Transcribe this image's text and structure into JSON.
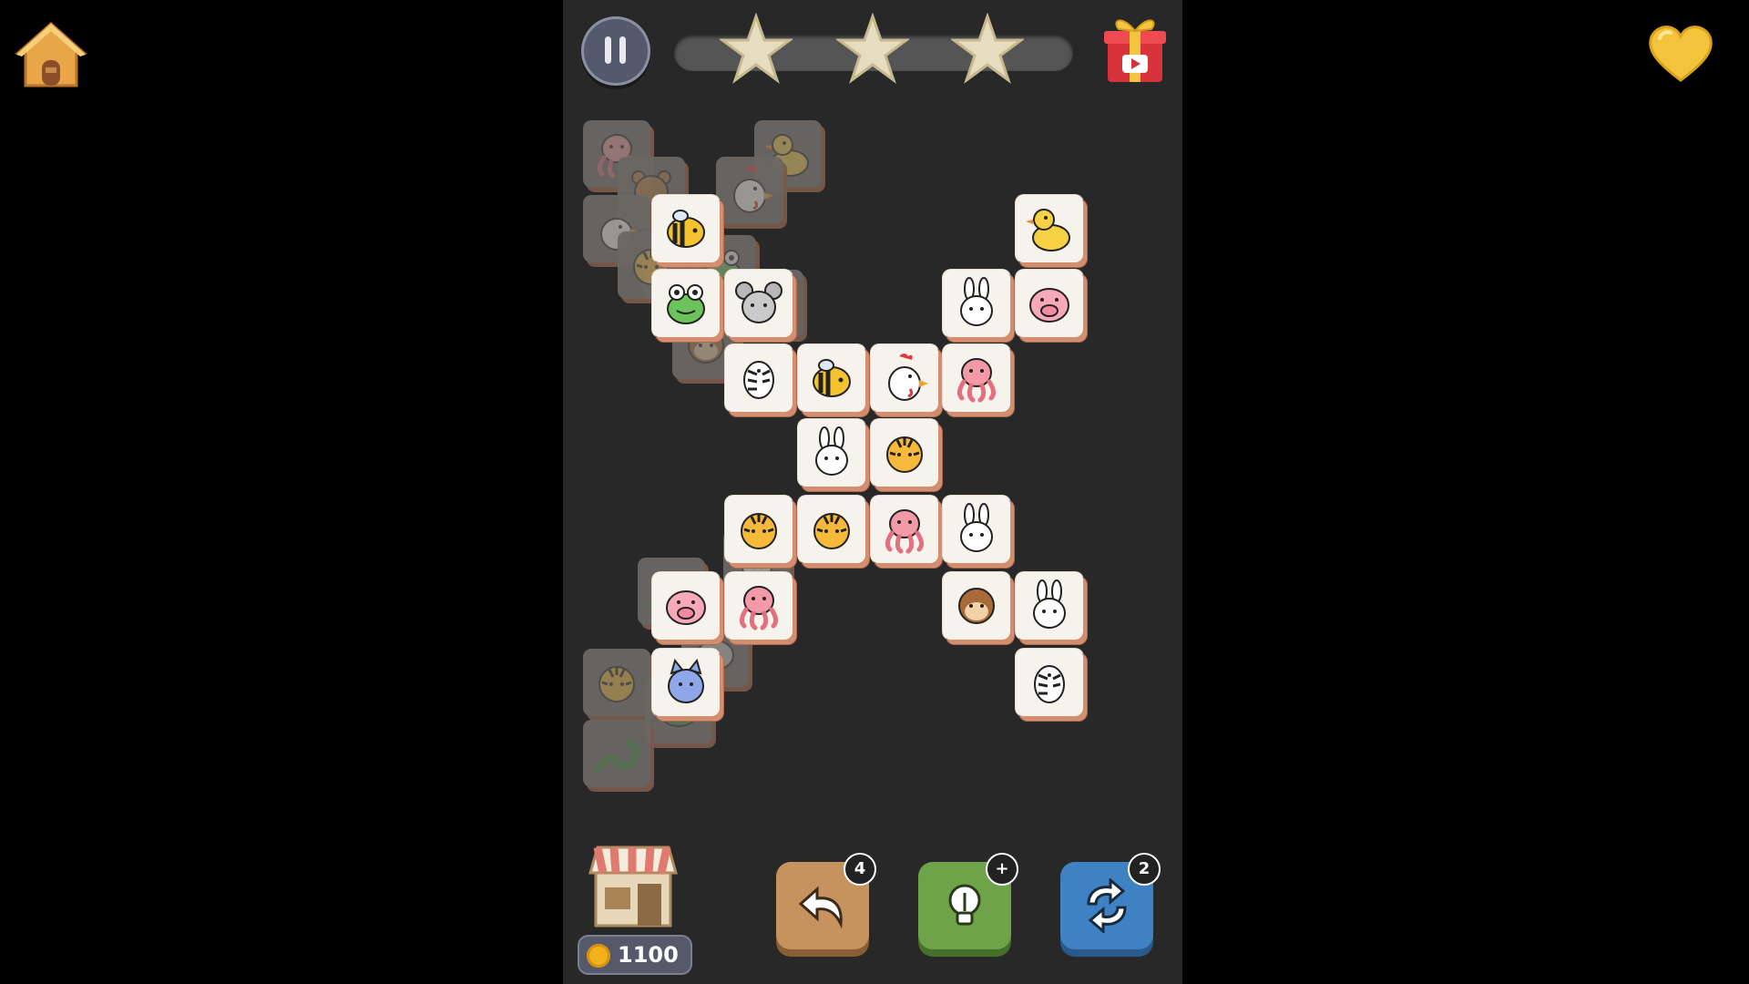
{
  "header": {
    "stars_earned": 3,
    "stars_total": 3
  },
  "footer": {
    "coins": "1100",
    "tools": {
      "undo_count": "4",
      "hint_count": "+",
      "shuffle_count": "2"
    }
  },
  "tiles": {
    "under": [
      "octopus",
      "duck",
      "bear",
      "rooster",
      "chicken",
      "zebra",
      "tiger",
      "frog",
      "tiger",
      "monkey",
      "tiger",
      "turtle",
      "snake",
      "elephant",
      "snake",
      "zebra"
    ],
    "top": [
      "bee",
      "duck",
      "frog",
      "mouse",
      "rabbit",
      "pig",
      "zebra",
      "bee",
      "rooster",
      "octopus",
      "rabbit",
      "tiger",
      "tiger",
      "tiger",
      "octopus",
      "rabbit",
      "pig",
      "octopus",
      "monkey",
      "rabbit",
      "cat",
      "zebra"
    ]
  },
  "colors": {
    "background": "#000000",
    "board": "#282828",
    "tile_face": "#f6f3ec",
    "tile_side": "#d28e6e"
  }
}
